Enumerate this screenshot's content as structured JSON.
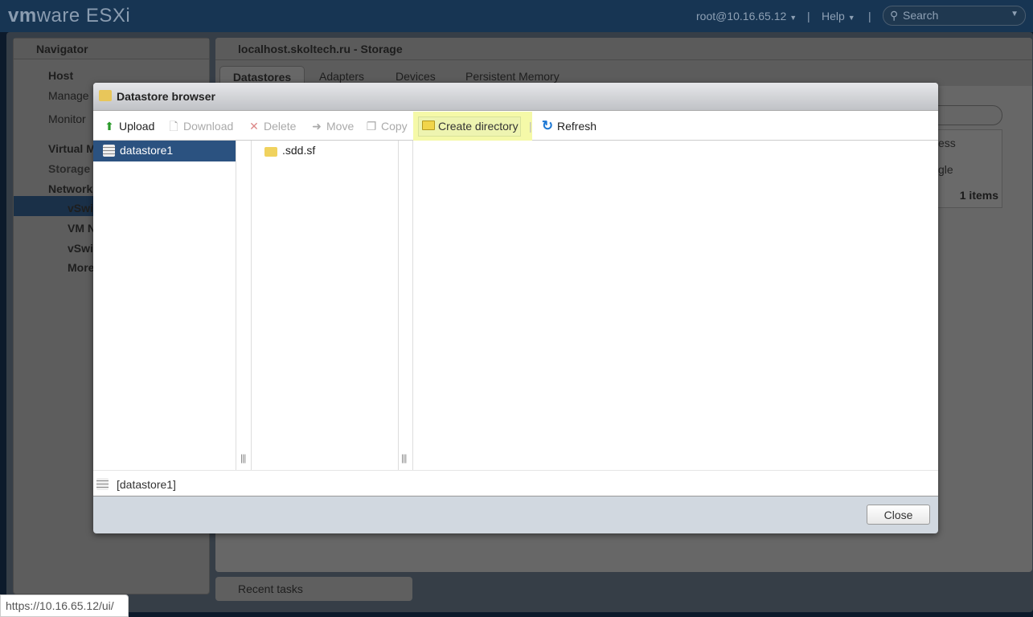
{
  "topbar": {
    "logo_vm": "vm",
    "logo_ware": "ware",
    "logo_product": "ESXi",
    "user": "root@10.16.65.12",
    "help": "Help",
    "search_placeholder": "Search"
  },
  "navigator": {
    "title": "Navigator",
    "items": [
      {
        "label": "Host",
        "bold": true
      },
      {
        "label": "Manage"
      },
      {
        "label": "Monitor"
      },
      {
        "label": "Virtual M",
        "bold": true
      },
      {
        "label": "Storage",
        "bold": true,
        "selected": true
      },
      {
        "label": "Networki",
        "bold": true
      },
      {
        "label": "vSwi",
        "bold": true
      },
      {
        "label": "VM N",
        "bold": true
      },
      {
        "label": "vSwi",
        "bold": true
      },
      {
        "label": "More",
        "bold": true
      }
    ]
  },
  "main": {
    "title": "localhost.skoltech.ru - Storage",
    "tabs": [
      "Datastores",
      "Adapters",
      "Devices",
      "Persistent Memory"
    ],
    "active_tab": "Datastores",
    "grid": {
      "col_header_fragment": "ess",
      "row_fragment": "gle",
      "footer": "1 items"
    }
  },
  "recent_tasks": "Recent tasks",
  "status_url": "https://10.16.65.12/ui/",
  "dialog": {
    "title": "Datastore browser",
    "toolbar": [
      {
        "label": "Upload",
        "enabled": true,
        "icon": "upload-arrow-icon"
      },
      {
        "label": "Download",
        "enabled": false,
        "icon": "download-icon"
      },
      {
        "label": "Delete",
        "enabled": false,
        "icon": "delete-icon"
      },
      {
        "label": "Move",
        "enabled": false,
        "icon": "move-icon"
      },
      {
        "label": "Copy",
        "enabled": false,
        "icon": "copy-icon"
      },
      {
        "label": "Create directory",
        "enabled": true,
        "highlighted": true,
        "icon": "new-folder-icon"
      },
      {
        "label": "Refresh",
        "enabled": true,
        "icon": "refresh-icon"
      }
    ],
    "datastores": [
      "datastore1"
    ],
    "folders": [
      ".sdd.sf"
    ],
    "path": "[datastore1]",
    "close_label": "Close"
  },
  "colors": {
    "highlight": "#f5f9a8",
    "selected_row": "#2b5280",
    "topbar": "#173553"
  }
}
